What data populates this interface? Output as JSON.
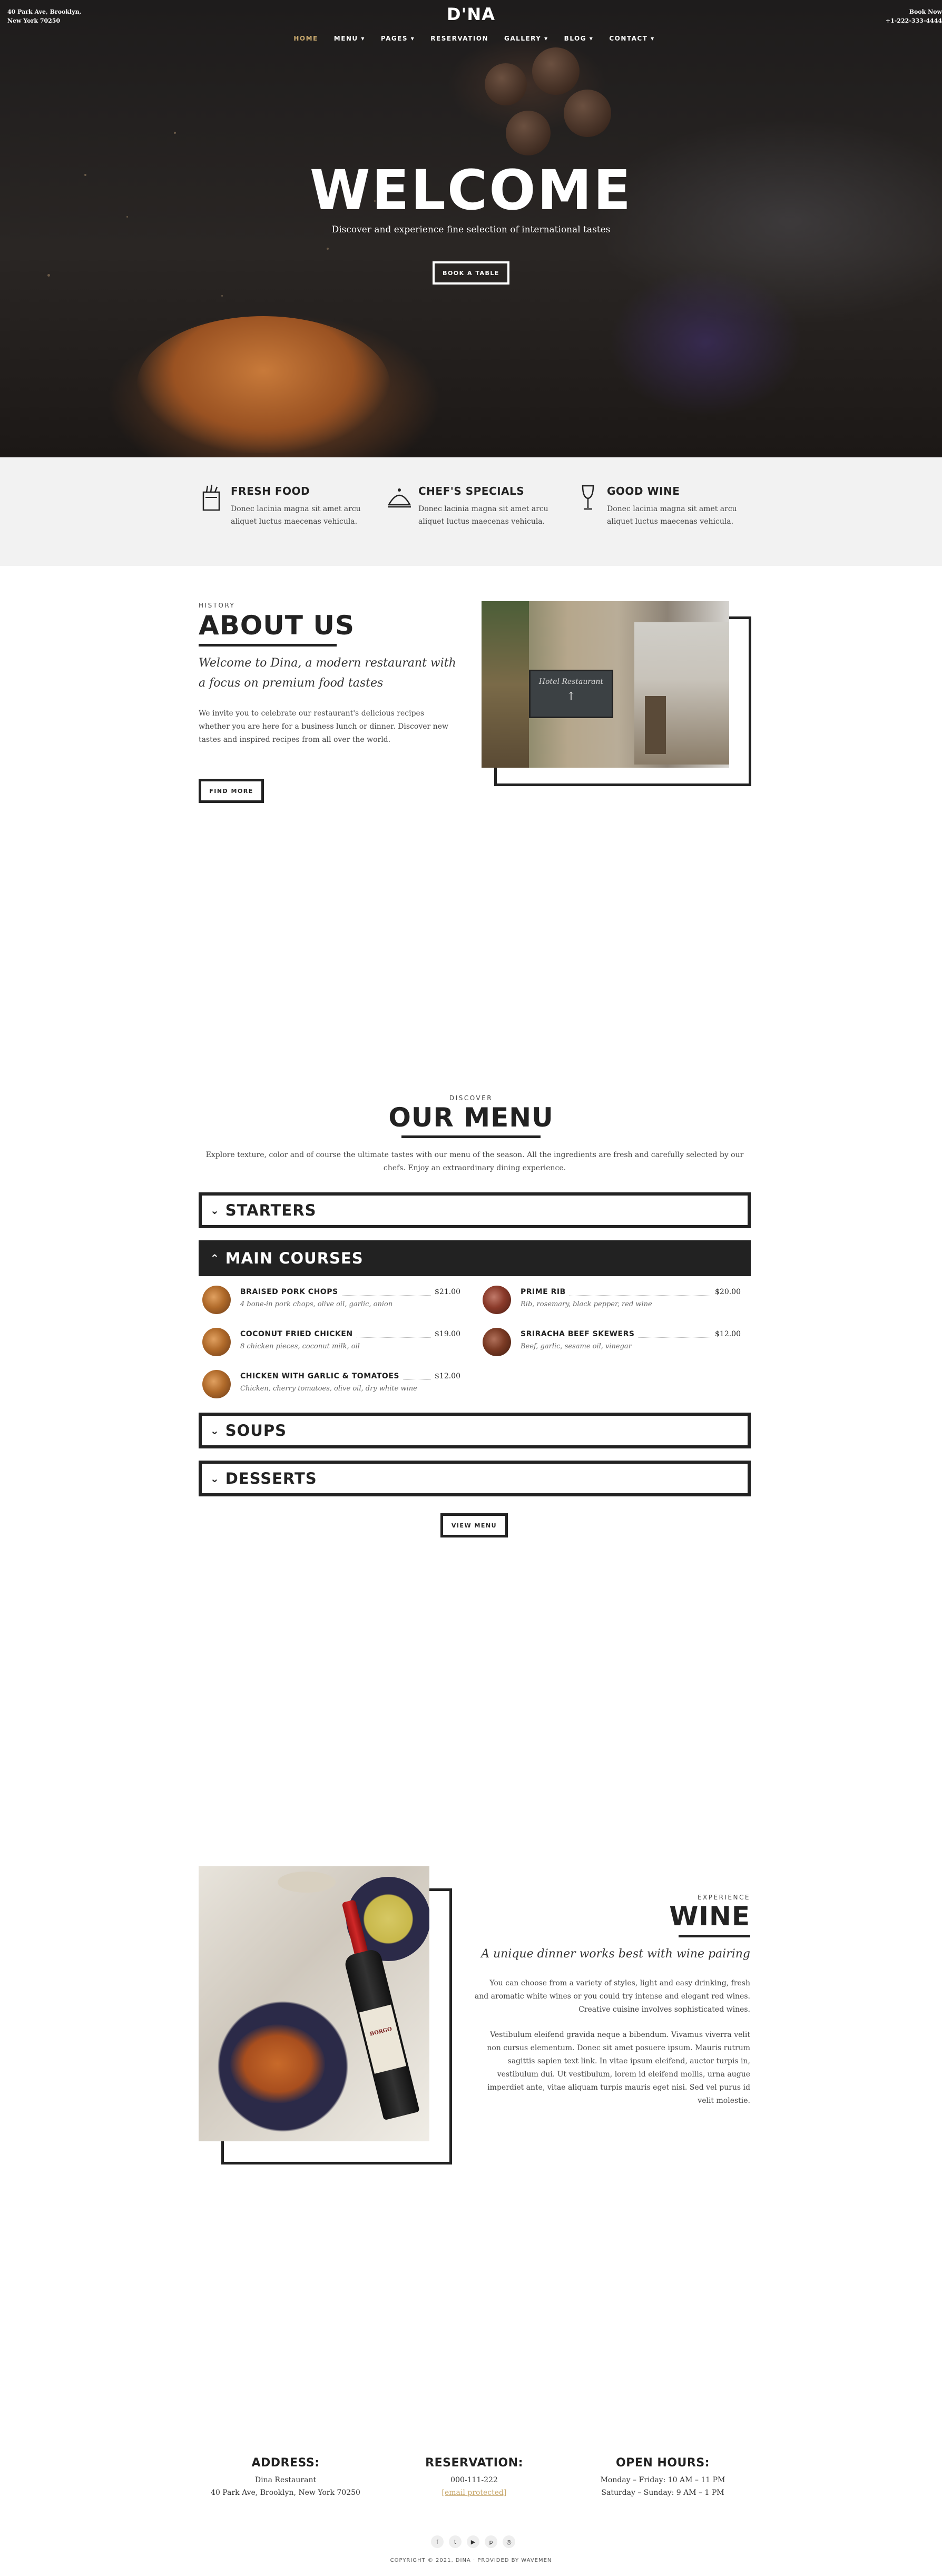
{
  "header": {
    "address_line1": "40 Park Ave, Brooklyn,",
    "address_line2": "New York 70250",
    "logo": "D'NA",
    "book_label": "Book Now",
    "phone": "+1-222-333-4444",
    "nav": [
      {
        "label": "HOME",
        "chevron": ""
      },
      {
        "label": "MENU",
        "chevron": "▾"
      },
      {
        "label": "PAGES",
        "chevron": "▾"
      },
      {
        "label": "RESERVATION",
        "chevron": ""
      },
      {
        "label": "GALLERY",
        "chevron": "▾"
      },
      {
        "label": "BLOG",
        "chevron": "▾"
      },
      {
        "label": "CONTACT",
        "chevron": "▾"
      }
    ]
  },
  "hero": {
    "title": "WELCOME",
    "subtitle": "Discover and experience fine selection of international tastes",
    "button": "BOOK A TABLE"
  },
  "features": [
    {
      "title": "FRESH FOOD",
      "text": "Donec lacinia magna sit amet arcu aliquet luctus maecenas vehicula.",
      "icon": "grocery-bag-icon"
    },
    {
      "title": "CHEF'S SPECIALS",
      "text": "Donec lacinia magna sit amet arcu aliquet luctus maecenas vehicula.",
      "icon": "cloche-icon"
    },
    {
      "title": "GOOD WINE",
      "text": "Donec lacinia magna sit amet arcu aliquet luctus maecenas vehicula.",
      "icon": "wine-glass-icon"
    }
  ],
  "about": {
    "eyebrow": "HISTORY",
    "title": "ABOUT US",
    "lead": "Welcome to Dina, a modern restaurant with a focus on premium food tastes",
    "body": "We invite you to celebrate our restaurant's delicious recipes whether you are here for a business lunch or dinner. Discover new tastes and inspired recipes from all over the world.",
    "button": "FIND MORE",
    "image_sign": "Hotel Restaurant"
  },
  "menu": {
    "eyebrow": "DISCOVER",
    "title": "OUR MENU",
    "intro": "Explore texture, color and of course the ultimate tastes with our menu of the season. All the ingredients are fresh and carefully selected by our chefs. Enjoy an extraordinary dining experience.",
    "sections": [
      {
        "label": "STARTERS",
        "chevron": "⌄"
      },
      {
        "label": "MAIN COURSES",
        "chevron": "⌃"
      },
      {
        "label": "SOUPS",
        "chevron": "⌄"
      },
      {
        "label": "DESSERTS",
        "chevron": "⌄"
      }
    ],
    "items": [
      {
        "name": "BRAISED PORK CHOPS",
        "price": "$21.00",
        "desc": "4 bone-in pork chops, olive oil, garlic, onion"
      },
      {
        "name": "PRIME RIB",
        "price": "$20.00",
        "desc": "Rib, rosemary, black pepper, red wine"
      },
      {
        "name": "COCONUT FRIED CHICKEN",
        "price": "$19.00",
        "desc": "8 chicken pieces, coconut milk, oil"
      },
      {
        "name": "SRIRACHA BEEF SKEWERS",
        "price": "$12.00",
        "desc": "Beef, garlic, sesame oil, vinegar"
      },
      {
        "name": "CHICKEN WITH GARLIC & TOMATOES",
        "price": "$12.00",
        "desc": "Chicken, cherry tomatoes, olive oil, dry white wine"
      }
    ],
    "button": "VIEW MENU"
  },
  "wine": {
    "eyebrow": "EXPERIENCE",
    "title": "WINE",
    "lead": "A unique dinner works best with wine pairing",
    "p1": "You can choose from a variety of styles, light and easy drinking, fresh and aromatic white wines or you could try intense and elegant red wines. Creative cuisine involves sophisticated wines.",
    "p2": "Vestibulum eleifend gravida neque a bibendum. Vivamus viverra velit non cursus elementum. Donec sit amet posuere ipsum. Mauris rutrum sagittis sapien text link. In vitae ipsum eleifend, auctor turpis in, vestibulum dui. Ut vestibulum, lorem id eleifend mollis, urna augue imperdiet ante, vitae aliquam turpis mauris eget nisi. Sed vel purus id velit molestie.",
    "bottle_label": "BORGO"
  },
  "footer": {
    "address": {
      "heading": "ADDRESS:",
      "line1": "Dina Restaurant",
      "line2": "40 Park Ave, Brooklyn, New York 70250"
    },
    "reservation": {
      "heading": "RESERVATION:",
      "line1": "000-111-222",
      "line2": "[email protected]"
    },
    "hours": {
      "heading": "OPEN HOURS:",
      "line1": "Monday – Friday: 10 AM – 11 PM",
      "line2": "Saturday – Sunday: 9 AM – 1 PM"
    },
    "social": [
      {
        "icon": "facebook-icon",
        "glyph": "f"
      },
      {
        "icon": "twitter-icon",
        "glyph": "t"
      },
      {
        "icon": "youtube-icon",
        "glyph": "▶"
      },
      {
        "icon": "pinterest-icon",
        "glyph": "p"
      },
      {
        "icon": "instagram-icon",
        "glyph": "◎"
      }
    ],
    "copyright": "COPYRIGHT © 2021, DINA · PROVIDED BY WAVEMEN"
  },
  "colors": {
    "accent": "#c9a96e",
    "dark": "#222222",
    "features_bg": "#f2f2f2"
  }
}
